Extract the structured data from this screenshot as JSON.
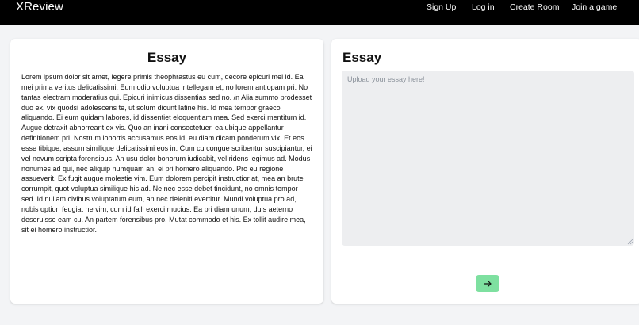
{
  "navbar": {
    "brand": "XReview",
    "links": [
      "Sign Up",
      "Log in",
      "Create Room",
      "Join a game"
    ]
  },
  "left_panel": {
    "title": "Essay",
    "text": "Lorem ipsum dolor sit amet, legere primis theophrastus eu cum, decore epicuri mel id. Ea mei prima veritus delicatissimi. Eum odio voluptua intellegam et, no lorem antiopam pri. No tantas electram moderatius qui. Epicuri inimicus dissentias sed no. /n Alia summo prodesset duo ex, vix quodsi adolescens te, ut solum dicunt latine his. Id mea tempor graeco aliquando. Ei eum quidam labores, id dissentiet eloquentiam mea. Sed exerci mentitum id. Augue detraxit abhorreant ex vis. Quo an inani consectetuer, ea ubique appellantur definitionem pri. Nostrum lobortis accusamus eos id,  eu diam dicam ponderum vix. Et eos esse tibique, assum similique delicatissimi eos in. Cum cu congue scribentur suscipiantur, ei vel novum scripta forensibus. An usu dolor bonorum iudicabit, vel ridens legimus ad. Modus nonumes ad qui, nec aliquip numquam an, ei pri homero aliquando. Pro eu regione assueverit. Ex fugit augue molestie vim. Eum dolorem percipit instructior at, mea an brute corrumpit, quot voluptua similique his ad. Ne nec esse debet tincidunt, no omnis tempor sed. Id nullam civibus voluptatum eum, an nec deleniti evertitur. Mundi voluptua pro ad, nobis option feugiat ne vim, cum id falli exerci mucius. Ea pri diam unum, duis aeterno deseruisse eam cu. An partem forensibus pro. Mutat commodo et his. Ex tollit audire mea, sit ei homero instructior."
  },
  "right_panel": {
    "title": "Essay",
    "textarea": {
      "placeholder": "Upload your essay here!",
      "value": ""
    },
    "submit_icon": "arrow-right-icon"
  },
  "colors": {
    "navbar_bg": "#000000",
    "page_bg": "#f3f4f6",
    "textarea_bg": "#edeef0",
    "submit_bg": "#7ee0a0"
  }
}
